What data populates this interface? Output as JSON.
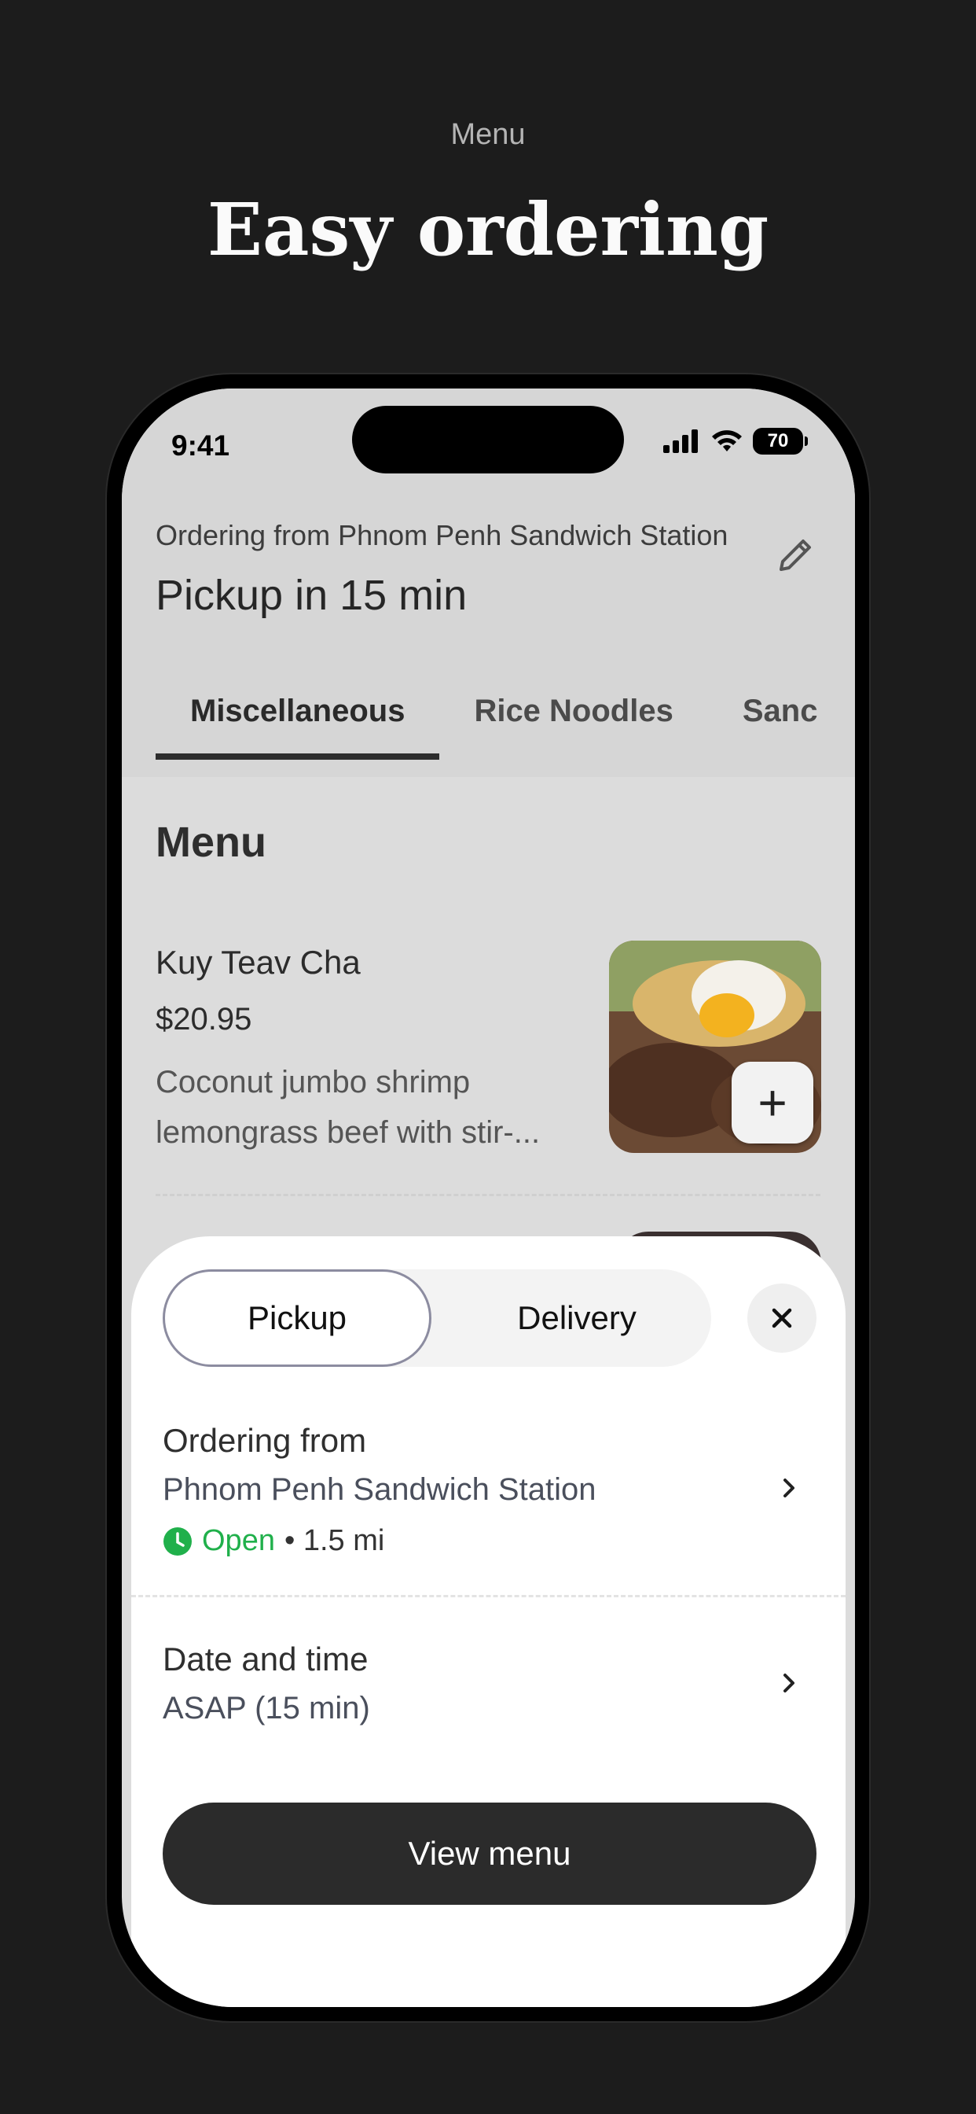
{
  "promo": {
    "label": "Menu",
    "title": "Easy ordering"
  },
  "status_bar": {
    "time": "9:41",
    "battery": "70",
    "icons": [
      "signal-icon",
      "wifi-icon",
      "battery-icon"
    ]
  },
  "header": {
    "ordering_from": "Ordering from Phnom Penh Sandwich Station",
    "pickup_time": "Pickup in 15 min"
  },
  "tabs": [
    {
      "label": "Miscellaneous",
      "active": true
    },
    {
      "label": "Rice Noodles",
      "active": false
    },
    {
      "label": "Sanc",
      "active": false
    }
  ],
  "menu": {
    "heading": "Menu",
    "item": {
      "name": "Kuy Teav Cha",
      "price": "$20.95",
      "description_line1": "Coconut jumbo shrimp",
      "description_line2": "lemongrass beef with stir-..."
    }
  },
  "sheet": {
    "segment_pickup": "Pickup",
    "segment_delivery": "Delivery",
    "ordering_label": "Ordering from",
    "store_name": "Phnom Penh Sandwich Station",
    "open_text": "Open",
    "distance": "• 1.5 mi",
    "datetime_label": "Date and time",
    "datetime_value": "ASAP (15 min)",
    "view_menu": "View menu"
  },
  "colors": {
    "background": "#1c1c1c",
    "open_green": "#20b04b",
    "button_dark": "#2b2b2b"
  }
}
